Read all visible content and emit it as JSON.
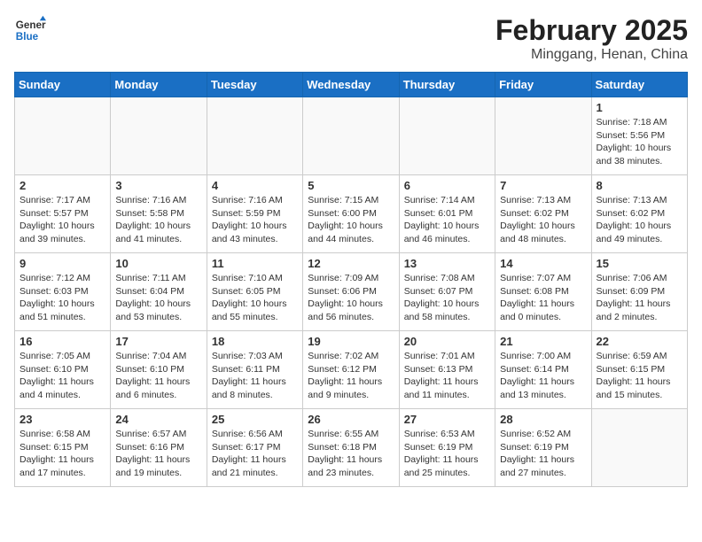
{
  "header": {
    "logo_line1": "General",
    "logo_line2": "Blue",
    "title": "February 2025",
    "subtitle": "Minggang, Henan, China"
  },
  "weekdays": [
    "Sunday",
    "Monday",
    "Tuesday",
    "Wednesday",
    "Thursday",
    "Friday",
    "Saturday"
  ],
  "weeks": [
    [
      {
        "day": "",
        "info": ""
      },
      {
        "day": "",
        "info": ""
      },
      {
        "day": "",
        "info": ""
      },
      {
        "day": "",
        "info": ""
      },
      {
        "day": "",
        "info": ""
      },
      {
        "day": "",
        "info": ""
      },
      {
        "day": "1",
        "info": "Sunrise: 7:18 AM\nSunset: 5:56 PM\nDaylight: 10 hours and 38 minutes."
      }
    ],
    [
      {
        "day": "2",
        "info": "Sunrise: 7:17 AM\nSunset: 5:57 PM\nDaylight: 10 hours and 39 minutes."
      },
      {
        "day": "3",
        "info": "Sunrise: 7:16 AM\nSunset: 5:58 PM\nDaylight: 10 hours and 41 minutes."
      },
      {
        "day": "4",
        "info": "Sunrise: 7:16 AM\nSunset: 5:59 PM\nDaylight: 10 hours and 43 minutes."
      },
      {
        "day": "5",
        "info": "Sunrise: 7:15 AM\nSunset: 6:00 PM\nDaylight: 10 hours and 44 minutes."
      },
      {
        "day": "6",
        "info": "Sunrise: 7:14 AM\nSunset: 6:01 PM\nDaylight: 10 hours and 46 minutes."
      },
      {
        "day": "7",
        "info": "Sunrise: 7:13 AM\nSunset: 6:02 PM\nDaylight: 10 hours and 48 minutes."
      },
      {
        "day": "8",
        "info": "Sunrise: 7:13 AM\nSunset: 6:02 PM\nDaylight: 10 hours and 49 minutes."
      }
    ],
    [
      {
        "day": "9",
        "info": "Sunrise: 7:12 AM\nSunset: 6:03 PM\nDaylight: 10 hours and 51 minutes."
      },
      {
        "day": "10",
        "info": "Sunrise: 7:11 AM\nSunset: 6:04 PM\nDaylight: 10 hours and 53 minutes."
      },
      {
        "day": "11",
        "info": "Sunrise: 7:10 AM\nSunset: 6:05 PM\nDaylight: 10 hours and 55 minutes."
      },
      {
        "day": "12",
        "info": "Sunrise: 7:09 AM\nSunset: 6:06 PM\nDaylight: 10 hours and 56 minutes."
      },
      {
        "day": "13",
        "info": "Sunrise: 7:08 AM\nSunset: 6:07 PM\nDaylight: 10 hours and 58 minutes."
      },
      {
        "day": "14",
        "info": "Sunrise: 7:07 AM\nSunset: 6:08 PM\nDaylight: 11 hours and 0 minutes."
      },
      {
        "day": "15",
        "info": "Sunrise: 7:06 AM\nSunset: 6:09 PM\nDaylight: 11 hours and 2 minutes."
      }
    ],
    [
      {
        "day": "16",
        "info": "Sunrise: 7:05 AM\nSunset: 6:10 PM\nDaylight: 11 hours and 4 minutes."
      },
      {
        "day": "17",
        "info": "Sunrise: 7:04 AM\nSunset: 6:10 PM\nDaylight: 11 hours and 6 minutes."
      },
      {
        "day": "18",
        "info": "Sunrise: 7:03 AM\nSunset: 6:11 PM\nDaylight: 11 hours and 8 minutes."
      },
      {
        "day": "19",
        "info": "Sunrise: 7:02 AM\nSunset: 6:12 PM\nDaylight: 11 hours and 9 minutes."
      },
      {
        "day": "20",
        "info": "Sunrise: 7:01 AM\nSunset: 6:13 PM\nDaylight: 11 hours and 11 minutes."
      },
      {
        "day": "21",
        "info": "Sunrise: 7:00 AM\nSunset: 6:14 PM\nDaylight: 11 hours and 13 minutes."
      },
      {
        "day": "22",
        "info": "Sunrise: 6:59 AM\nSunset: 6:15 PM\nDaylight: 11 hours and 15 minutes."
      }
    ],
    [
      {
        "day": "23",
        "info": "Sunrise: 6:58 AM\nSunset: 6:15 PM\nDaylight: 11 hours and 17 minutes."
      },
      {
        "day": "24",
        "info": "Sunrise: 6:57 AM\nSunset: 6:16 PM\nDaylight: 11 hours and 19 minutes."
      },
      {
        "day": "25",
        "info": "Sunrise: 6:56 AM\nSunset: 6:17 PM\nDaylight: 11 hours and 21 minutes."
      },
      {
        "day": "26",
        "info": "Sunrise: 6:55 AM\nSunset: 6:18 PM\nDaylight: 11 hours and 23 minutes."
      },
      {
        "day": "27",
        "info": "Sunrise: 6:53 AM\nSunset: 6:19 PM\nDaylight: 11 hours and 25 minutes."
      },
      {
        "day": "28",
        "info": "Sunrise: 6:52 AM\nSunset: 6:19 PM\nDaylight: 11 hours and 27 minutes."
      },
      {
        "day": "",
        "info": ""
      }
    ]
  ]
}
